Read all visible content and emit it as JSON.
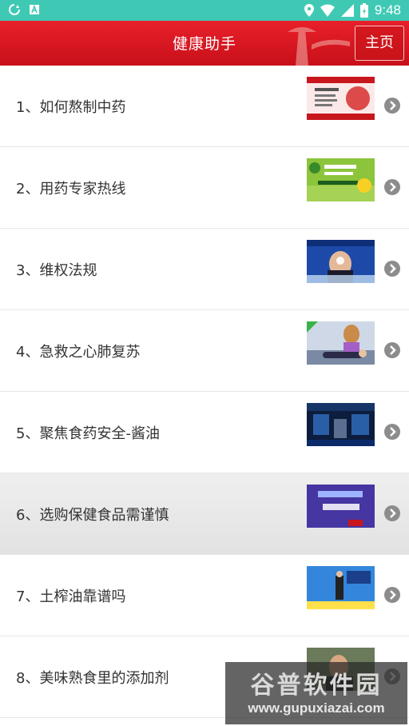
{
  "status_bar": {
    "time": "9:48"
  },
  "header": {
    "title": "健康助手",
    "home_label": "主页"
  },
  "items": [
    {
      "label": "1、如何熬制中药"
    },
    {
      "label": "2、用药专家热线"
    },
    {
      "label": "3、维权法规"
    },
    {
      "label": "4、急救之心肺复苏"
    },
    {
      "label": "5、聚焦食药安全-酱油"
    },
    {
      "label": "6、选购保健食品需谨慎"
    },
    {
      "label": "7、土榨油靠谱吗"
    },
    {
      "label": "8、美味熟食里的添加剂"
    }
  ],
  "watermark": {
    "logo_text": "谷普软件园",
    "url": "www.gupuxiazai.com"
  }
}
